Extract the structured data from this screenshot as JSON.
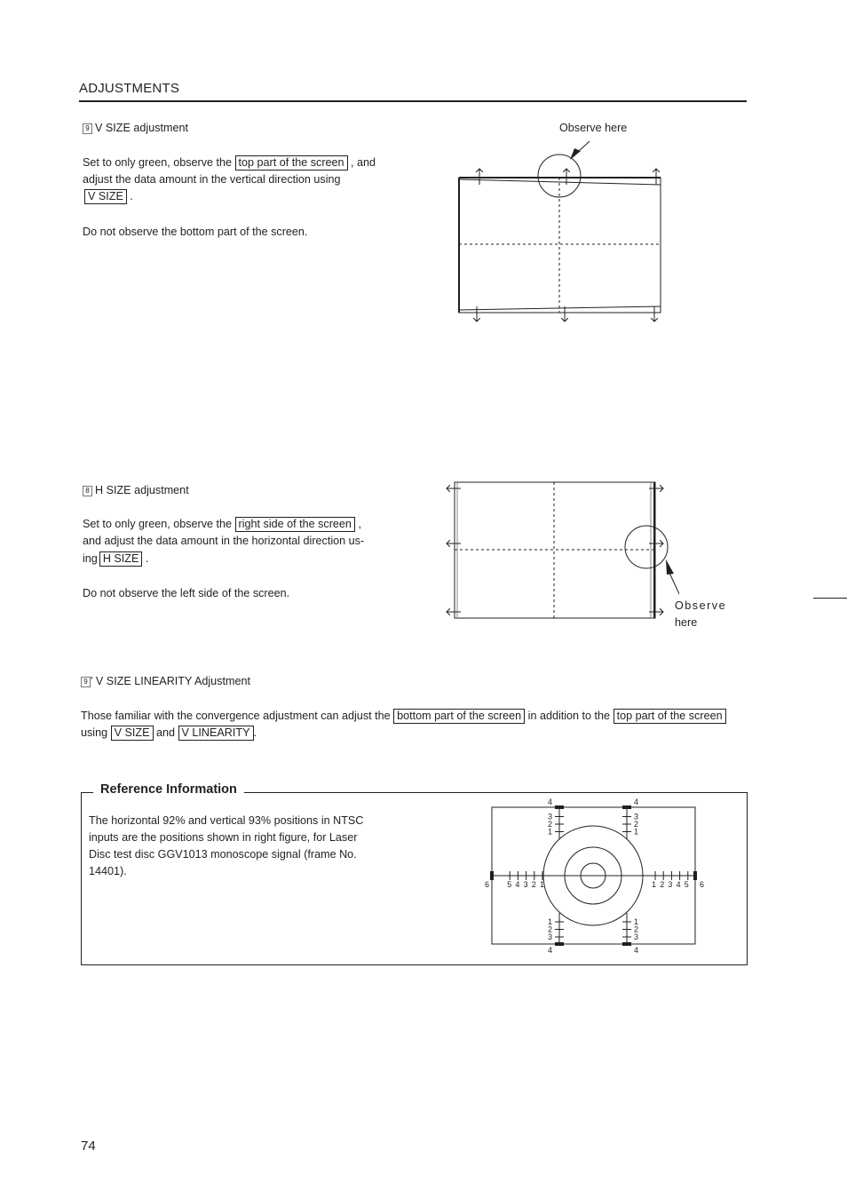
{
  "header": {
    "section_title": "ADJUSTMENTS"
  },
  "v_size": {
    "number": "9",
    "heading": "V SIZE adjustment",
    "line1_pre": "Set to only green, observe the",
    "line1_box": "top part of the screen",
    "line1_post": ", and",
    "line2": "adjust the data amount in the vertical direction using",
    "line3_box": "V SIZE",
    "line3_post": ".",
    "note": "Do not observe the bottom part of the screen.",
    "figure_label": "Observe here"
  },
  "h_size": {
    "number": "8",
    "heading": "H SIZE adjustment",
    "line1_pre": "Set to only green, observe the",
    "line1_box": "right side of the screen",
    "line1_post": ",",
    "line2": "and adjust the data amount in the horizontal direction us-",
    "line3_pre": "ing",
    "line3_box": "H SIZE",
    "line3_post": ".",
    "note": "Do not observe the left side of the screen.",
    "figure_label_1": "Observe",
    "figure_label_2": "here"
  },
  "v_linearity": {
    "number": "9",
    "heading": "' V SIZE LINEARITY Adjustment",
    "line1_pre": "Those familiar with the convergence adjustment can adjust the",
    "line1_box1": "bottom part of the screen",
    "line1_mid": "in addition to the",
    "line1_box2": "top part of the screen",
    "line2_pre": "using",
    "line2_box1": "V SIZE",
    "line2_mid": "and",
    "line2_box2": "V LINEARITY",
    "line2_post": "."
  },
  "reference": {
    "title": "Reference Information",
    "lines": [
      "The horizontal 92% and vertical 93% positions in NTSC",
      "inputs are the positions shown in right figure, for Laser",
      "Disc test disc GGV1013 monoscope signal (frame No.",
      "14401)."
    ],
    "figure": {
      "left_labels": [
        "6",
        "5",
        "4",
        "3",
        "2",
        "1"
      ],
      "right_labels": [
        "1",
        "2",
        "3",
        "4",
        "5",
        "6"
      ],
      "top_labels": [
        "4",
        "3",
        "2",
        "1"
      ],
      "bottom_labels": [
        "1",
        "2",
        "3",
        "4"
      ]
    }
  },
  "footer": {
    "page_number": "74"
  }
}
